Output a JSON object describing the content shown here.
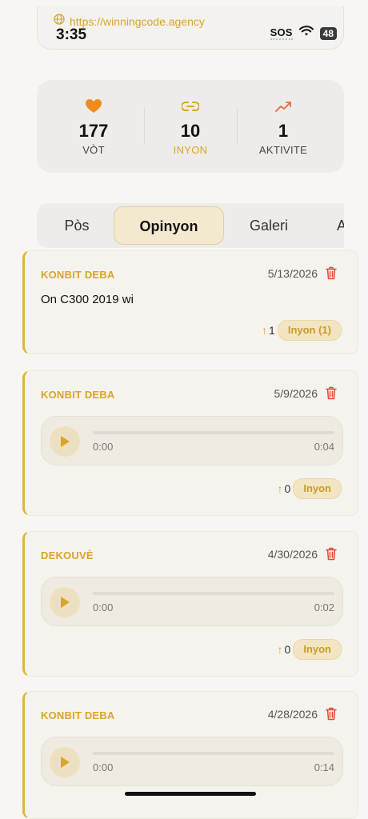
{
  "browser": {
    "url": "https://winningcode.agency",
    "time": "3:35",
    "sos": "SOS",
    "battery": "48"
  },
  "stats": [
    {
      "icon": "heart-icon",
      "value": "177",
      "label": "VÒT"
    },
    {
      "icon": "link-icon",
      "value": "10",
      "label": "INYON"
    },
    {
      "icon": "trending-up-icon",
      "value": "1",
      "label": "AKTIVITE"
    }
  ],
  "tabs": [
    "Pòs",
    "Opinyon",
    "Galeri",
    "A"
  ],
  "active_tab": "Opinyon",
  "cards": [
    {
      "category": "KONBIT DEBA",
      "date": "5/13/2026",
      "text": "On C300 2019 wi",
      "votes": "1",
      "link_label": "Inyon (1)"
    },
    {
      "category": "KONBIT DEBA",
      "date": "5/9/2026",
      "audio_current": "0:00",
      "audio_duration": "0:04",
      "votes": "0",
      "link_label": "Inyon"
    },
    {
      "category": "DEKOUVÈ",
      "date": "4/30/2026",
      "audio_current": "0:00",
      "audio_duration": "0:02",
      "votes": "0",
      "link_label": "Inyon"
    },
    {
      "category": "KONBIT DEBA",
      "date": "4/28/2026",
      "audio_current": "0:00",
      "audio_duration": "0:14"
    }
  ],
  "colors": {
    "accent": "#d9a52b",
    "heart": "#f08c1e",
    "delete": "#e0493d"
  }
}
